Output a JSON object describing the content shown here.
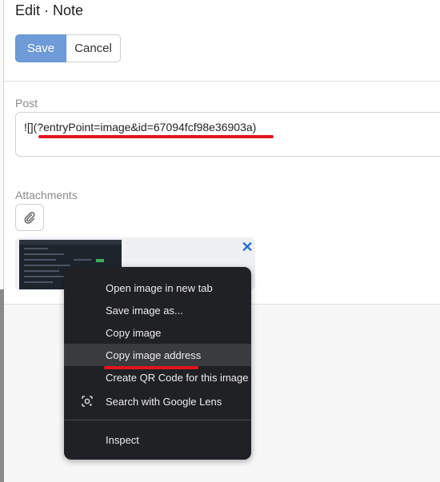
{
  "header": {
    "title": "Edit · Note",
    "save_label": "Save",
    "cancel_label": "Cancel"
  },
  "form": {
    "post_label": "Post",
    "post_value": "![](?entryPoint=image&id=67094fcf98e36903a)",
    "attachments_label": "Attachments"
  },
  "context_menu": {
    "items": [
      "Open image in new tab",
      "Save image as...",
      "Copy image",
      "Copy image address",
      "Create QR Code for this image",
      "Search with Google Lens",
      "Inspect"
    ],
    "highlighted": "Copy image address"
  },
  "colors": {
    "save_button": "#6f9bd8",
    "menu_background": "#202124",
    "annotation_red": "#e0151b",
    "remove_icon": "#2a6fd6"
  }
}
